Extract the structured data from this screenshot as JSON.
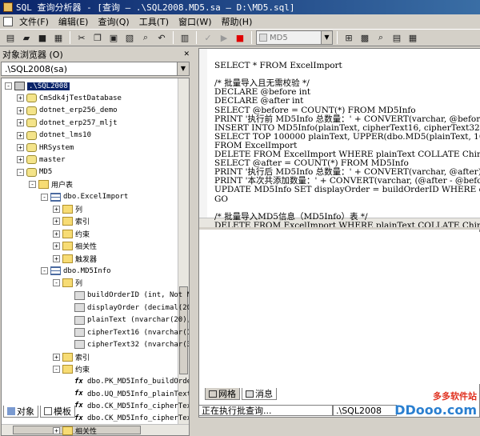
{
  "window": {
    "title": "SQL 查询分析器 - [查询 — .\\SQL2008.MD5.sa — D:\\MD5.sql]"
  },
  "menu": [
    "文件(F)",
    "编辑(E)",
    "查询(Q)",
    "工具(T)",
    "窗口(W)",
    "帮助(H)"
  ],
  "toolbar": {
    "database": "MD5"
  },
  "object_browser": {
    "title": "对象浏览器 (O)",
    "server": ".\\SQL2008(sa)",
    "tree": [
      {
        "label": ".\\SQL2008",
        "icon": "server-icon",
        "exp": "-",
        "level": 0,
        "selected": true
      },
      {
        "label": "CmSdk4jTestDatabase",
        "icon": "database-icon",
        "exp": "+",
        "level": 1
      },
      {
        "label": "dotnet_erp256_demo",
        "icon": "database-icon",
        "exp": "+",
        "level": 1
      },
      {
        "label": "dotnet_erp257_mljt",
        "icon": "database-icon",
        "exp": "+",
        "level": 1
      },
      {
        "label": "dotnet_lms10",
        "icon": "database-icon",
        "exp": "+",
        "level": 1
      },
      {
        "label": "HRSystem",
        "icon": "database-icon",
        "exp": "+",
        "level": 1
      },
      {
        "label": "master",
        "icon": "database-icon",
        "exp": "+",
        "level": 1
      },
      {
        "label": "MD5",
        "icon": "database-icon",
        "exp": "-",
        "level": 1
      },
      {
        "label": "用户表",
        "icon": "folder-icon",
        "exp": "-",
        "level": 2
      },
      {
        "label": "dbo.ExcelImport",
        "icon": "table-icon",
        "exp": "-",
        "level": 3
      },
      {
        "label": "列",
        "icon": "folder-icon",
        "exp": "+",
        "level": 4
      },
      {
        "label": "索引",
        "icon": "folder-icon",
        "exp": "+",
        "level": 4
      },
      {
        "label": "约束",
        "icon": "folder-icon",
        "exp": "+",
        "level": 4
      },
      {
        "label": "相关性",
        "icon": "folder-icon",
        "exp": "+",
        "level": 4
      },
      {
        "label": "触发器",
        "icon": "folder-icon",
        "exp": "+",
        "level": 4
      },
      {
        "label": "dbo.MD5Info",
        "icon": "table-icon",
        "exp": "-",
        "level": 3
      },
      {
        "label": "列",
        "icon": "folder-icon",
        "exp": "-",
        "level": 4
      },
      {
        "label": "buildOrderID (int, Not N",
        "icon": "column-icon",
        "exp": "",
        "level": 5
      },
      {
        "label": "displayOrder (decimal(20",
        "icon": "column-icon",
        "exp": "",
        "level": 5
      },
      {
        "label": "plainText (nvarchar(20),",
        "icon": "column-icon",
        "exp": "",
        "level": 5
      },
      {
        "label": "cipherText16 (nvarchar(1",
        "icon": "column-icon",
        "exp": "",
        "level": 5
      },
      {
        "label": "cipherText32 (nvarchar(3",
        "icon": "column-icon",
        "exp": "",
        "level": 5
      },
      {
        "label": "索引",
        "icon": "folder-icon",
        "exp": "+",
        "level": 4
      },
      {
        "label": "约束",
        "icon": "folder-icon",
        "exp": "-",
        "level": 4
      },
      {
        "label": "dbo.PK_MD5Info_buildOrde",
        "icon": "constraint-icon",
        "exp": "",
        "level": 5
      },
      {
        "label": "dbo.UQ_MD5Info_plainText",
        "icon": "constraint-icon",
        "exp": "",
        "level": 5
      },
      {
        "label": "dbo.CK_MD5Info_cipherTex",
        "icon": "constraint-icon",
        "exp": "",
        "level": 5
      },
      {
        "label": "dbo.CK_MD5Info_cipherTex",
        "icon": "constraint-icon",
        "exp": "",
        "level": 5
      },
      {
        "label": "相关性",
        "icon": "folder-icon",
        "exp": "+",
        "level": 4
      }
    ],
    "tabs": [
      "对象",
      "模板"
    ]
  },
  "editor": {
    "lines": [
      "SELECT * FROM ExcelImport",
      "",
      "/* 批量导入且无需校验 */",
      "DECLARE @before int",
      "DECLARE @after int",
      "SELECT @before = COUNT(*) FROM MD5Info",
      "PRINT '执行前 MD5Info 总数量：' + CONVERT(varchar, @before",
      "INSERT INTO MD5Info(plainText, cipherText16, cipherText32",
      "SELECT TOP 100000 plainText, UPPER(dbo.MD5(plainText, 16)",
      "FROM ExcelImport",
      "DELETE FROM ExcelImport WHERE plainText COLLATE Chinese_P",
      "SELECT @after = COUNT(*) FROM MD5Info",
      "PRINT '执行后 MD5Info 总数量：' + CONVERT(varchar, @after)",
      "PRINT '本次共添加数量：' + CONVERT(varchar, (@after - @befo",
      "UPDATE MD5Info SET displayOrder = buildOrderID WHERE disp",
      "GO",
      "",
      "/* 批量导入MD5信息（MD5Info）表 */",
      "DELETE FROM ExcelImport WHERE plainText COLLATE Chinese_P"
    ]
  },
  "results": {
    "tabs": [
      "网格",
      "消息"
    ]
  },
  "status": {
    "message": "正在执行批查询...",
    "server": ".\\SQL2008"
  },
  "watermark": {
    "cn": "多多软件站",
    "en": "DDooo.com"
  }
}
